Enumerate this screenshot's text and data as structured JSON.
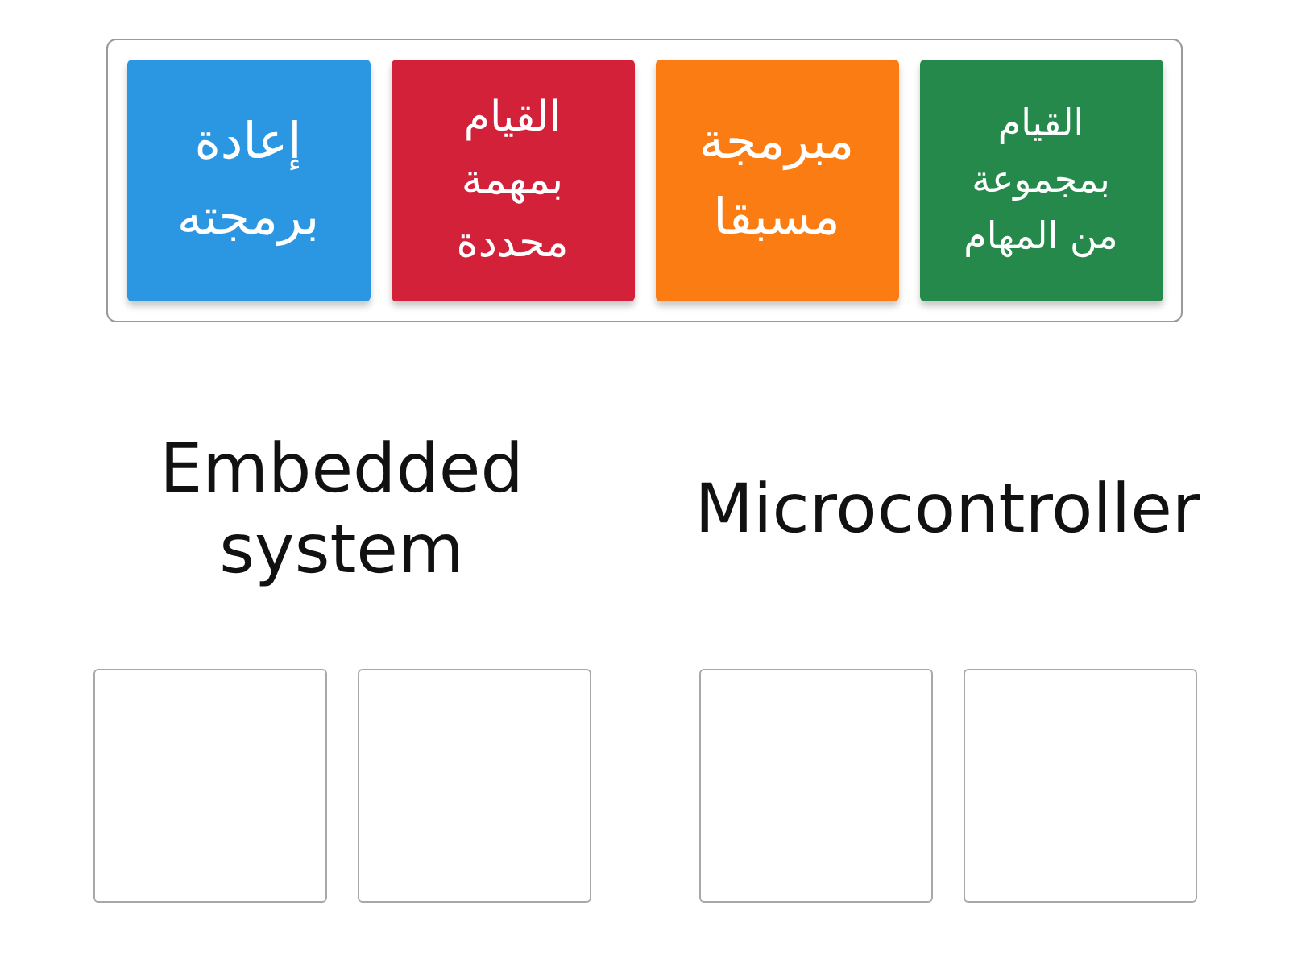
{
  "tray": {
    "tiles": [
      {
        "text": "القيام بمجموعة من المهام",
        "color": "#24894a"
      },
      {
        "text": "مبرمجة مسبقا",
        "color": "#fb7c12"
      },
      {
        "text": "القيام بمهمة محددة",
        "color": "#d4213a"
      },
      {
        "text": "إعادة برمجته",
        "color": "#2b97e3"
      }
    ]
  },
  "groups": [
    {
      "heading": "Microcontroller",
      "answer_boxes": [
        {
          "kind": "empty"
        },
        {
          "kind": "empty"
        }
      ]
    },
    {
      "heading": "Embedded system",
      "answer_boxes": [
        {
          "kind": "empty"
        },
        {
          "kind": "empty"
        }
      ]
    }
  ]
}
